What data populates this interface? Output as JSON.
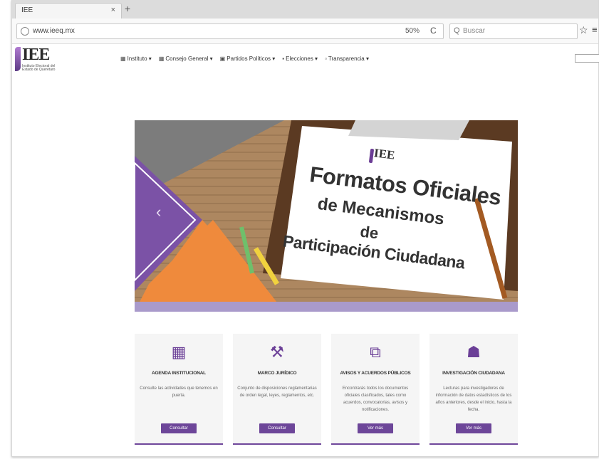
{
  "browser": {
    "tab_title": "IEE",
    "tab_close": "×",
    "new_tab": "+",
    "url": "www.ieeq.mx",
    "zoom": "50%",
    "reload": "C",
    "search_placeholder": "Buscar",
    "search_glyph": "Q",
    "bookmark_star": "☆",
    "toolbar_extra": "≡"
  },
  "site": {
    "logo_text": "IEE",
    "logo_subtitle": "Instituto Electoral del Estado de Querétaro",
    "menu": [
      {
        "icon": "▦",
        "label": "Instituto ▾"
      },
      {
        "icon": "▦",
        "label": "Consejo General ▾"
      },
      {
        "icon": "▣",
        "label": "Partidos Políticos ▾"
      },
      {
        "icon": "▪",
        "label": "Elecciones ▾"
      },
      {
        "icon": "▫",
        "label": "Transparencia ▾"
      }
    ]
  },
  "carousel": {
    "prev": "‹",
    "banner_logo": "IEE",
    "banner_lines": [
      "Formatos Oficiales",
      "de Mecanismos",
      "de",
      "Participación Ciudadana"
    ]
  },
  "cards": [
    {
      "icon": "calendar-icon",
      "glyph": "▦",
      "title": "AGENDA INSTITUCIONAL",
      "desc": "Consulte las actividades que tenemos en puerta.",
      "button": "Consultar"
    },
    {
      "icon": "gavel-icon",
      "glyph": "⚒",
      "title": "MARCO JURÍDICO",
      "desc": "Conjunto de disposiciones reglamentarias de orden legal, leyes, reglamentos, etc.",
      "button": "Consultar"
    },
    {
      "icon": "documents-icon",
      "glyph": "⧉",
      "title": "AVISOS Y ACUERDOS PÚBLICOS",
      "desc": "Encontrarás todos los documentos oficiales clasificados, tales como acuerdos, convocatorias, avisos y notificaciones.",
      "button": "Ver más"
    },
    {
      "icon": "people-icon",
      "glyph": "☗",
      "title": "INVESTIGACIÓN CIUDADANA",
      "desc": "Lecturas para investigadores de información de datos estadísticos de los años anteriores, desde el inicio, hasta la fecha.",
      "button": "Ver más"
    }
  ]
}
